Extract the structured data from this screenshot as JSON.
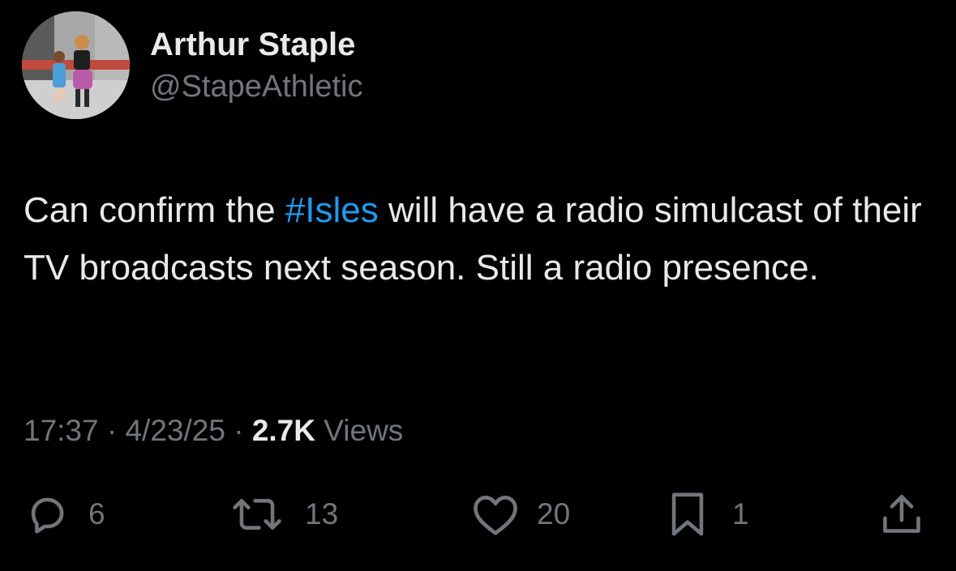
{
  "author": {
    "display_name": "Arthur Staple",
    "handle": "@StapeAthletic",
    "avatar": "avatar-photo-two-children-walking"
  },
  "tweet": {
    "text_before": "Can confirm the ",
    "hashtag": "#Isles",
    "text_after": " will have a radio simulcast of their TV broadcasts next season. Still a radio presence."
  },
  "meta": {
    "time": "17:37",
    "separator": " · ",
    "date": "4/23/25",
    "views_count": "2.7K",
    "views_label": " Views"
  },
  "actions": {
    "reply": {
      "icon": "reply-icon",
      "count": "6"
    },
    "retweet": {
      "icon": "retweet-icon",
      "count": "13"
    },
    "like": {
      "icon": "heart-icon",
      "count": "20"
    },
    "bookmark": {
      "icon": "bookmark-icon",
      "count": "1"
    },
    "share": {
      "icon": "share-icon"
    }
  },
  "colors": {
    "background": "#000000",
    "text": "#e7e9ea",
    "secondary": "#71767b",
    "link": "#1d9bf0"
  }
}
